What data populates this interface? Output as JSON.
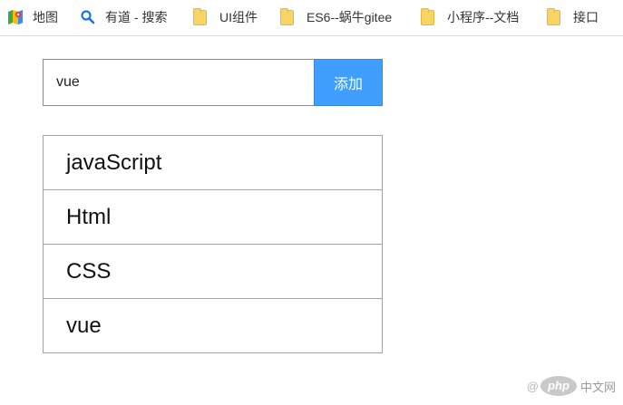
{
  "bookmarks": [
    {
      "label": "地图",
      "icon": "maps-icon"
    },
    {
      "label": "有道 - 搜索",
      "icon": "search-icon"
    },
    {
      "label": "UI组件",
      "icon": "folder-icon"
    },
    {
      "label": "ES6--蜗牛gitee",
      "icon": "folder-icon"
    },
    {
      "label": "小程序--文档",
      "icon": "folder-icon"
    },
    {
      "label": "接口",
      "icon": "folder-icon"
    }
  ],
  "form": {
    "input_value": "vue",
    "add_label": "添加"
  },
  "todos": [
    "javaScript",
    "Html",
    "CSS",
    "vue"
  ],
  "watermark": {
    "at": "@",
    "logo": "php",
    "text": "中文网"
  },
  "colors": {
    "button": "#409eff",
    "border": "#a3a3a3"
  }
}
